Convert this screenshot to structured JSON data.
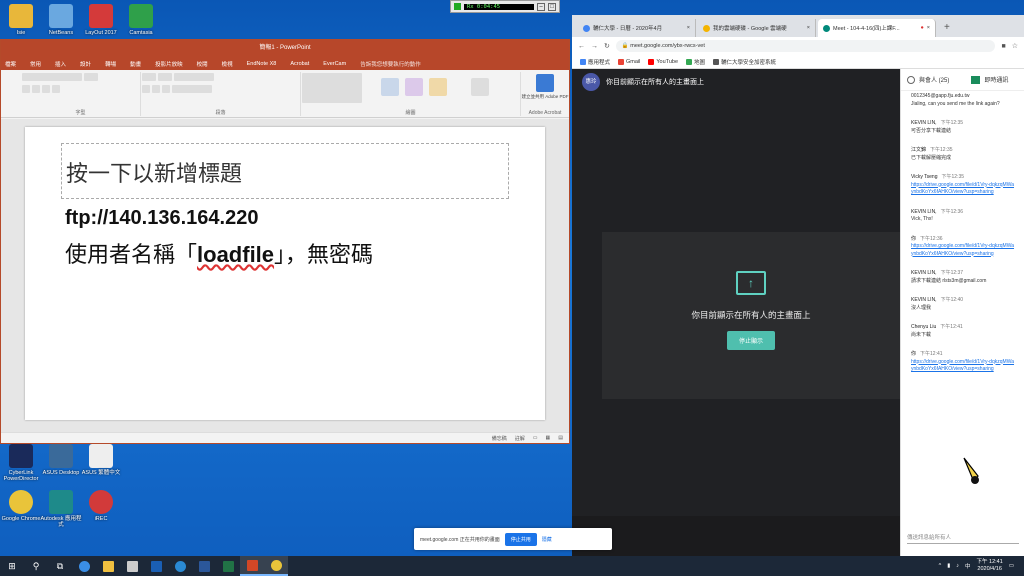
{
  "desktop_icons": [
    {
      "label": "Isie",
      "color": "#e8b73a"
    },
    {
      "label": "NetBeans",
      "color": "#6aa8e0"
    },
    {
      "label": "LayOut 2017",
      "color": "#d43a3a"
    },
    {
      "label": "Camtasia",
      "color": "#2fa04a"
    },
    {
      "label": "CyberLink PowerDirector",
      "color": "#1a2a5a"
    },
    {
      "label": "ASUS Desktop",
      "color": "#3a6a9a"
    },
    {
      "label": "ASUS 繁體中文",
      "color": "#eeeeee"
    },
    {
      "label": "Google Chrome",
      "color": "#e9c43a"
    },
    {
      "label": "Autodesk 應用程式",
      "color": "#1e8a8a"
    },
    {
      "label": "iREC",
      "color": "#d23a3a"
    }
  ],
  "recorder": {
    "time": "Rx 0:04:45"
  },
  "powerpoint": {
    "title": "簡報1 - PowerPoint",
    "tabs": [
      "檔案",
      "常用",
      "插入",
      "設計",
      "轉場",
      "動畫",
      "投影片放映",
      "校閱",
      "檢視",
      "EndNote X8",
      "Acrobat",
      "EverCam"
    ],
    "search": "告訴我您想要執行的動作",
    "groups": [
      "字型",
      "段落",
      "繪圖",
      "Adobe Acrobat"
    ],
    "acrobat_btn": "建立並共用 Adobe PDF",
    "slide": {
      "title_placeholder": "按一下以新增標題",
      "ftp": "ftp://140.136.164.220",
      "user_prefix": "使用者名稱「",
      "user_name": "loadfile",
      "user_suffix": "」，無密碼"
    },
    "status": [
      "備忘稿",
      "註解"
    ]
  },
  "chrome": {
    "tabs": [
      {
        "title": "輔仁大學 - 日曆 - 2020年4月",
        "color": "#4285f4"
      },
      {
        "title": "我的雲端硬碟 - Google 雲端硬",
        "color": "#f4b400"
      },
      {
        "title": "Meet - 104-4-16(四)上課F...",
        "color": "#00897b"
      }
    ],
    "new_tab": "+",
    "url": "meet.google.com/ybx-rwcs-vet",
    "bookmarks": [
      {
        "label": "應用程式",
        "color": "#4285f4"
      },
      {
        "label": "Gmail",
        "color": "#ea4335"
      },
      {
        "label": "YouTube",
        "color": "#ff0000"
      },
      {
        "label": "地圖",
        "color": "#34a853"
      },
      {
        "label": "輔仁大學安全加密系統",
        "color": "#555555"
      }
    ]
  },
  "meet": {
    "avatar": "惠玲",
    "banner": "你目前顯示在所有人的主畫面上",
    "present_icon": "up-arrow-icon",
    "present_text": "你目前顯示在所有人的主畫面上",
    "stop_button": "停止顯示",
    "people_label": "與會人 (25)",
    "chat_label": "即時通訊",
    "chat_input_placeholder": "傳送訊息給所有人",
    "messages": [
      {
        "who": "",
        "time": "",
        "text": "0012345@gapp.fju.edu.tw",
        "link": "",
        "extra": "Jialing, can you send me the link again?"
      },
      {
        "who": "KEVIN LIN,",
        "time": "下午12:35",
        "text": "可否分享下載連結",
        "link": "",
        "extra": ""
      },
      {
        "who": "江文錦",
        "time": "下午12:35",
        "text": "已下載解壓縮完成",
        "link": "",
        "extra": ""
      },
      {
        "who": "Vicky Tseng",
        "time": "下午12:35",
        "text": "",
        "link": "https://drive.google.com/file/d/1Vry-dqkzqMWaynbdKoYx6fAHKO/view?usp=sharing",
        "extra": ""
      },
      {
        "who": "KEVIN LIN,",
        "time": "下午12:36",
        "text": "Vick, Thx!",
        "link": "",
        "extra": ""
      },
      {
        "who": "你",
        "time": "下午12:36",
        "text": "",
        "link": "https://drive.google.com/file/d/1Vry-dqkzqMWaynbdKoYx6fAHKO/view?usp=sharing",
        "extra": ""
      },
      {
        "who": "KEVIN LIN,",
        "time": "下午12:37",
        "text": "請求下載連結 rlsts3m@gmail.com",
        "link": "",
        "extra": ""
      },
      {
        "who": "KEVIN LIN,",
        "time": "下午12:40",
        "text": "沒人理我",
        "link": "",
        "extra": ""
      },
      {
        "who": "Chenyu Liu",
        "time": "下午12:41",
        "text": "尚未下載",
        "link": "",
        "extra": ""
      },
      {
        "who": "你",
        "time": "下午12:41",
        "text": "",
        "link": "https://drive.google.com/file/d/1Vry-dqkzqMWaynbdKoYx6fAHKO/view?usp=sharing",
        "extra": ""
      }
    ]
  },
  "share_bar": {
    "text": "meet.google.com 正在共用你的畫面",
    "stop": "停止共用",
    "hide": "隱藏"
  },
  "taskbar": {
    "apps": [
      {
        "name": "start",
        "color": "#ffffff"
      },
      {
        "name": "search",
        "color": "#ffffff"
      },
      {
        "name": "task-view",
        "color": "#ffffff"
      },
      {
        "name": "edge",
        "color": "#3a8ee6"
      },
      {
        "name": "file-explorer",
        "color": "#f0c040"
      },
      {
        "name": "store",
        "color": "#cccccc"
      },
      {
        "name": "outlook",
        "color": "#1a5fb4"
      },
      {
        "name": "ie",
        "color": "#2a8ad4"
      },
      {
        "name": "word",
        "color": "#2b579a"
      },
      {
        "name": "excel",
        "color": "#217346"
      },
      {
        "name": "powerpoint",
        "color": "#d24726"
      },
      {
        "name": "chrome",
        "color": "#e9c43a"
      }
    ],
    "time": "下午 12:41",
    "date": "2020/4/16",
    "ime": "中"
  }
}
